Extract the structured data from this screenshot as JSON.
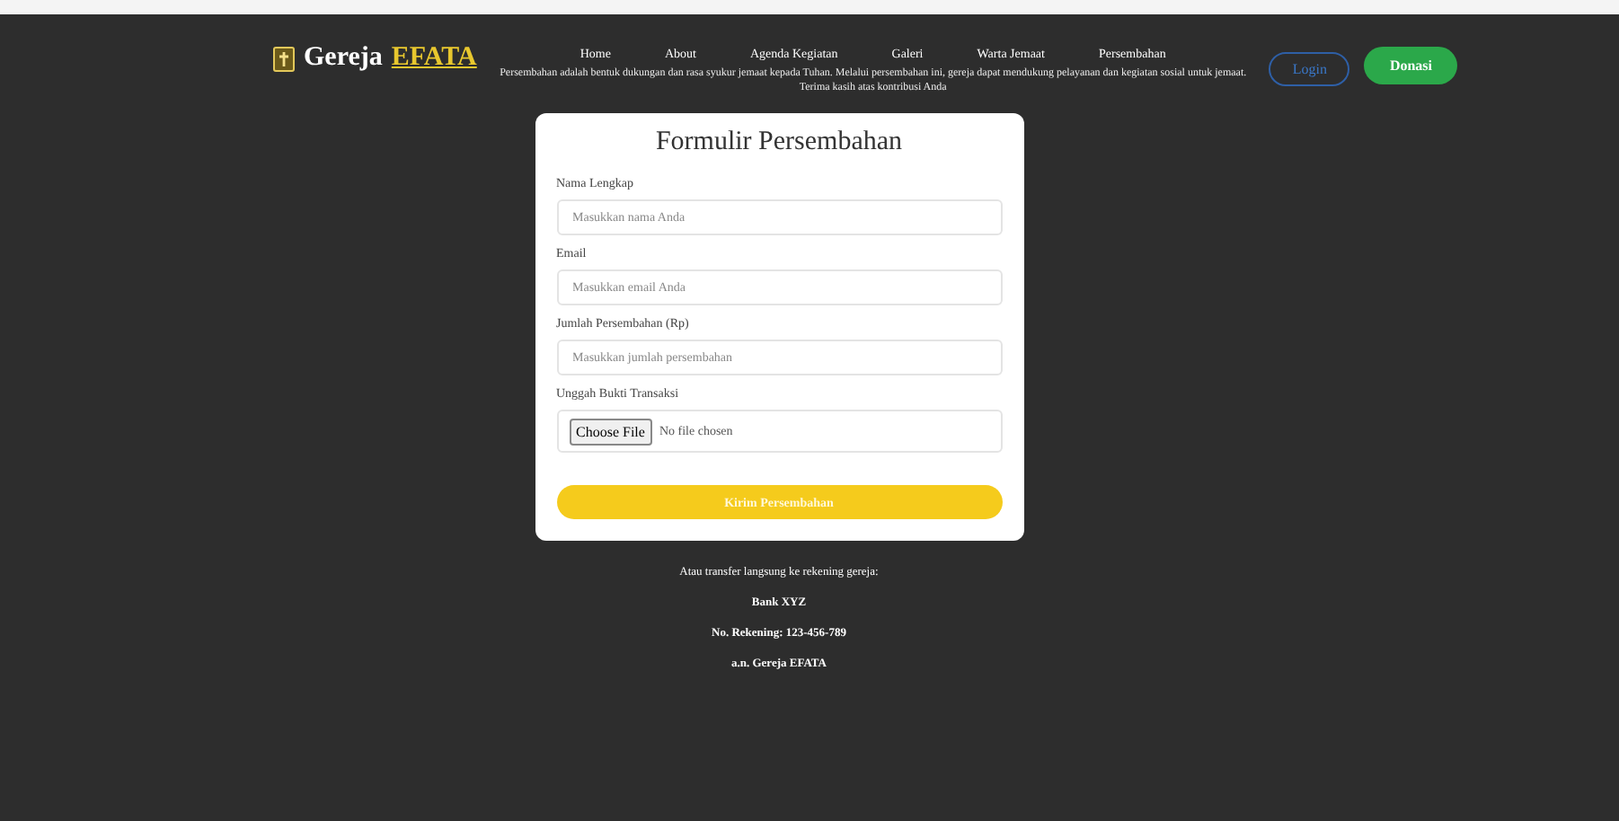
{
  "header": {
    "logo_name": "Gereja",
    "logo_highlight": "EFATA",
    "nav": [
      {
        "label": "Home"
      },
      {
        "label": "About"
      },
      {
        "label": "Agenda Kegiatan"
      },
      {
        "label": "Galeri"
      },
      {
        "label": "Warta Jemaat"
      },
      {
        "label": "Persembahan"
      }
    ],
    "login": "Login",
    "donate": "Donasi",
    "intro": "Persembahan adalah bentuk dukungan dan rasa syukur jemaat kepada Tuhan. Melalui persembahan ini, gereja dapat mendukung pelayanan dan kegiatan sosial untuk jemaat. Terima kasih atas kontribusi Anda"
  },
  "form": {
    "title": "Formulir Persembahan",
    "fields": [
      {
        "kind": "text",
        "label": "Nama Lengkap",
        "placeholder": "Masukkan nama Anda"
      },
      {
        "kind": "text",
        "label": "Email",
        "placeholder": "Masukkan email Anda"
      },
      {
        "kind": "text",
        "label": "Jumlah Persembahan (Rp)",
        "placeholder": "Masukkan jumlah persembahan"
      },
      {
        "kind": "file",
        "label": "Unggah Bukti Transaksi",
        "button": "Choose File",
        "status": "No file chosen"
      }
    ],
    "submit": "Kirim Persembahan"
  },
  "footer": {
    "lines": [
      {
        "text": "Atau transfer langsung ke rekening gereja:",
        "bold": false
      },
      {
        "text": "Bank XYZ",
        "bold": true
      },
      {
        "text": "No. Rekening: 123-456-789",
        "bold": true
      },
      {
        "text": "a.n. Gereja EFATA",
        "bold": true
      }
    ]
  }
}
